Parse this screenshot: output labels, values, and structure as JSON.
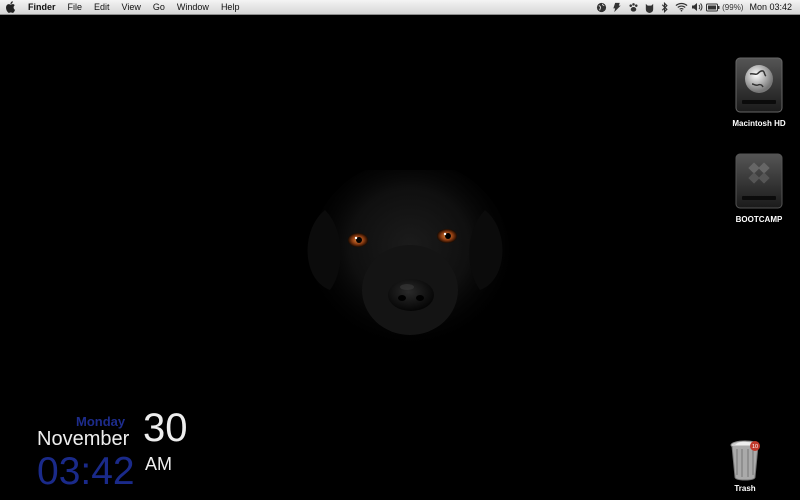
{
  "menubar": {
    "apple_icon": "apple-logo",
    "app_name": "Finder",
    "menus": [
      "File",
      "Edit",
      "View",
      "Go",
      "Window",
      "Help"
    ],
    "status_icons": [
      "globe-icon",
      "script-icon",
      "paw-icon",
      "growl-icon",
      "bluetooth-icon",
      "wifi-icon",
      "volume-icon",
      "battery-icon"
    ],
    "battery_percent": "(99%)",
    "clock": "Mon 03:42"
  },
  "desktop": {
    "icons": [
      {
        "label": "Macintosh HD",
        "icon": "hard-drive-icon"
      },
      {
        "label": "BOOTCAMP",
        "icon": "bootcamp-drive-icon"
      },
      {
        "label": "Trash",
        "icon": "trash-icon"
      }
    ],
    "trash_badge": "10"
  },
  "widget": {
    "day": "Monday",
    "month": "November",
    "date": "30",
    "time": "03:42",
    "ampm": "AM"
  },
  "colors": {
    "wallpaper": "#000000",
    "widget_blue": "#1a2a8a",
    "widget_white": "#eeeeee"
  }
}
